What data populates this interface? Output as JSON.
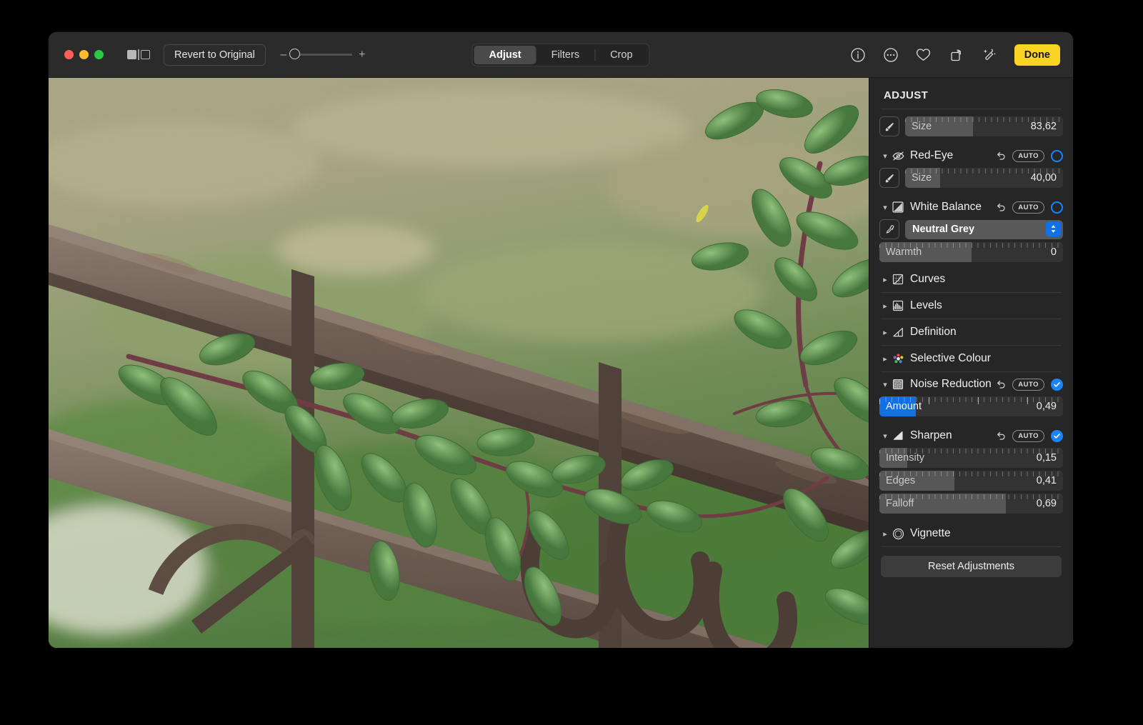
{
  "window": {
    "traffic_lights": [
      "close",
      "minimize",
      "zoom"
    ],
    "sidebar_toggle_icon": "sidebar-toggle-icon"
  },
  "toolbar": {
    "revert_label": "Revert to Original",
    "zoom_minus": "–",
    "zoom_plus": "+",
    "tabs": [
      {
        "label": "Adjust",
        "active": true
      },
      {
        "label": "Filters",
        "active": false
      },
      {
        "label": "Crop",
        "active": false
      }
    ],
    "right_icons": [
      "info-icon",
      "more-icon",
      "favorite-heart-icon",
      "rotate-icon",
      "auto-enhance-wand-icon"
    ],
    "done_label": "Done",
    "done_color": "#f9d423"
  },
  "sidebar": {
    "title": "ADJUST",
    "accent_blue": "#1a84ff",
    "retouch_size": {
      "label": "Size",
      "value": "83,62",
      "fill_pct": 43,
      "tool_icon": "brush-icon"
    },
    "sections": [
      {
        "id": "red-eye",
        "name": "Red-Eye",
        "icon": "eye-slash-icon",
        "expanded": true,
        "revert_icon": "revert-arrow-icon",
        "auto_label": "AUTO",
        "enabled": false,
        "slider": {
          "label": "Size",
          "value": "40,00",
          "fill_pct": 22,
          "tool_icon": "brush-icon"
        }
      },
      {
        "id": "white-balance",
        "name": "White Balance",
        "icon": "white-balance-icon",
        "expanded": true,
        "revert_icon": "revert-arrow-icon",
        "auto_label": "AUTO",
        "enabled": false,
        "popup": {
          "value": "Neutral Grey",
          "tool_icon": "eyedropper-icon"
        },
        "slider": {
          "label": "Warmth",
          "value": "0",
          "fill_pct": 50
        }
      },
      {
        "id": "curves",
        "name": "Curves",
        "icon": "curves-icon",
        "expanded": false
      },
      {
        "id": "levels",
        "name": "Levels",
        "icon": "levels-icon",
        "expanded": false
      },
      {
        "id": "definition",
        "name": "Definition",
        "icon": "definition-icon",
        "expanded": false
      },
      {
        "id": "selective-colour",
        "name": "Selective Colour",
        "icon": "selective-colour-icon",
        "expanded": false
      },
      {
        "id": "noise-reduction",
        "name": "Noise Reduction",
        "icon": "noise-reduction-icon",
        "expanded": true,
        "revert_icon": "revert-arrow-icon",
        "auto_label": "AUTO",
        "enabled": true,
        "slider": {
          "label": "Amount",
          "value": "0,49",
          "fill_pct": 20,
          "highlighted": true
        }
      },
      {
        "id": "sharpen",
        "name": "Sharpen",
        "icon": "sharpen-icon",
        "expanded": true,
        "revert_icon": "revert-arrow-icon",
        "auto_label": "AUTO",
        "enabled": true,
        "sliders": [
          {
            "label": "Intensity",
            "value": "0,15",
            "fill_pct": 15
          },
          {
            "label": "Edges",
            "value": "0,41",
            "fill_pct": 41
          },
          {
            "label": "Falloff",
            "value": "0,69",
            "fill_pct": 69
          }
        ]
      },
      {
        "id": "vignette",
        "name": "Vignette",
        "icon": "vignette-icon",
        "expanded": false
      }
    ],
    "reset_label": "Reset Adjustments"
  },
  "photo": {
    "description": "Rusty wrought-iron fence with green leafy branch against blurred grass field"
  }
}
